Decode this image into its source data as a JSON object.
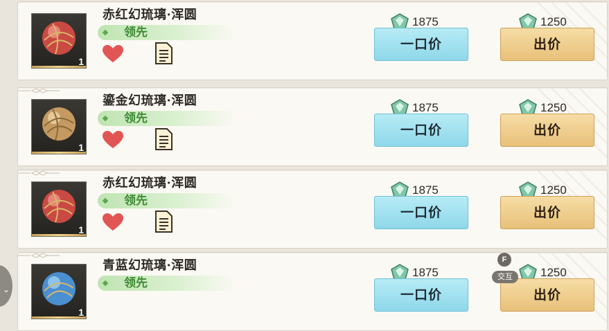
{
  "listings": [
    {
      "name": "赤红幻琉璃·浑圆",
      "status": "领先",
      "quantity": "1",
      "buyout_price": "1875",
      "bid_price": "1250",
      "buyout_label": "一口价",
      "bid_label": "出价",
      "orb_color": "#c94a43",
      "orb_highlight": "#f2a090"
    },
    {
      "name": "鎏金幻琉璃·浑圆",
      "status": "领先",
      "quantity": "1",
      "buyout_price": "1875",
      "bid_price": "1250",
      "buyout_label": "一口价",
      "bid_label": "出价",
      "orb_color": "#c49a62",
      "orb_highlight": "#f3dcae"
    },
    {
      "name": "赤红幻琉璃·浑圆",
      "status": "领先",
      "quantity": "1",
      "buyout_price": "1875",
      "bid_price": "1250",
      "buyout_label": "一口价",
      "bid_label": "出价",
      "orb_color": "#c94a43",
      "orb_highlight": "#f2a090"
    },
    {
      "name": "青蓝幻琉璃·浑圆",
      "status": "领先",
      "quantity": "1",
      "buyout_price": "1875",
      "bid_price": "1250",
      "buyout_label": "一口价",
      "bid_label": "出价",
      "orb_color": "#4a8fd0",
      "orb_highlight": "#a9d8f6"
    }
  ],
  "overlay": {
    "hotkey": "F",
    "interact_label": "交互"
  },
  "colors": {
    "lead_green": "#3f8d34",
    "buyout_blue": "#8fd8ea",
    "bid_gold": "#e8c07a",
    "heart_red": "#e25555"
  },
  "icons": {
    "currency": "jade-gem-icon",
    "favorite": "heart-icon",
    "details": "document-icon"
  }
}
